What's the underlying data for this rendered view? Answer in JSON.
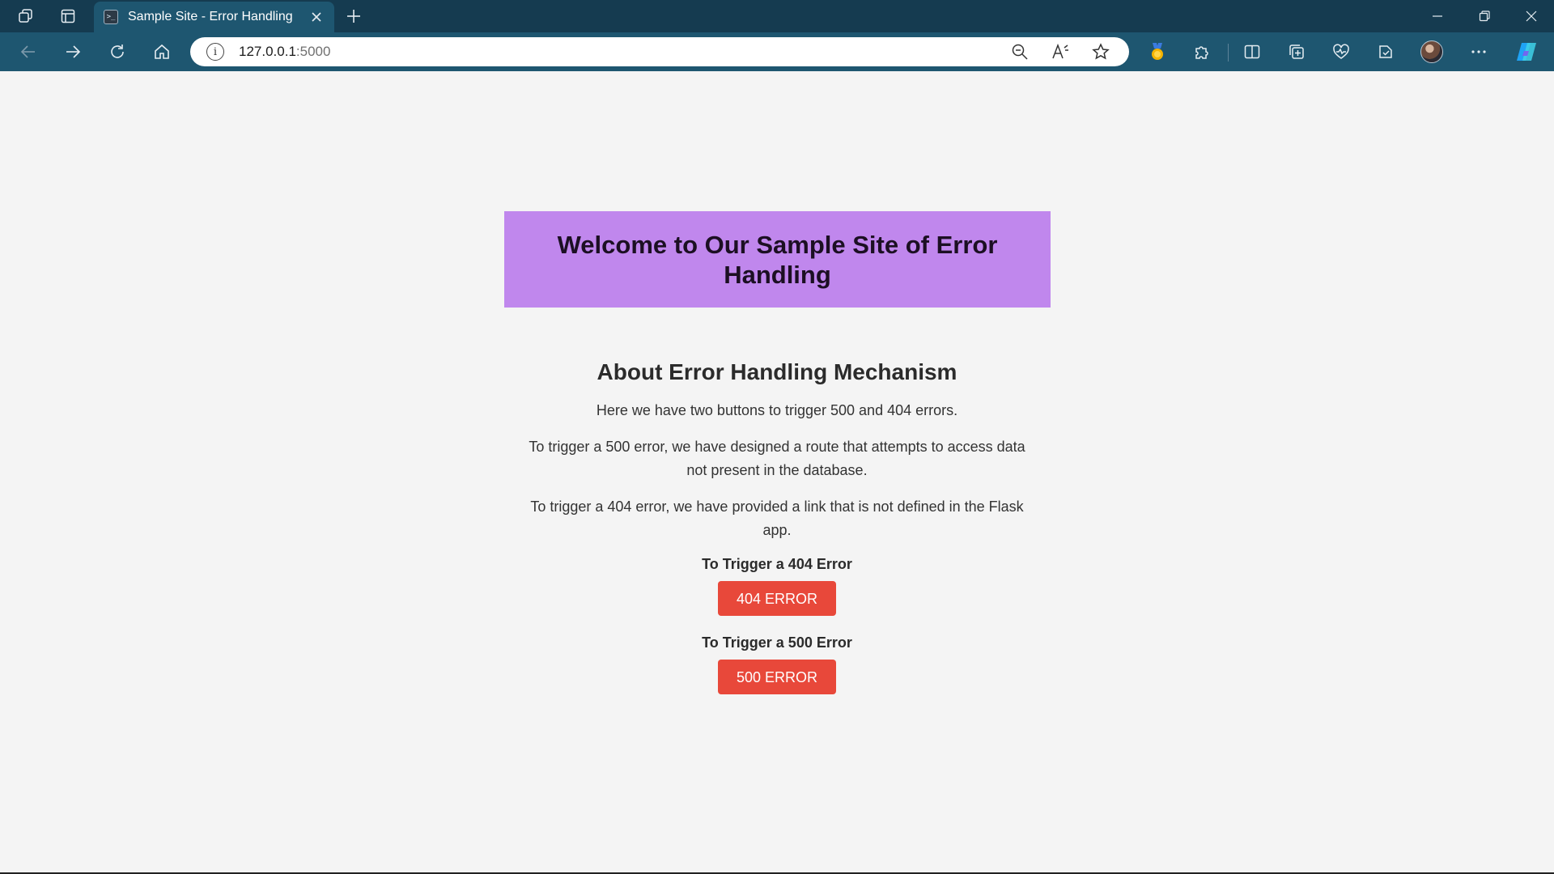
{
  "browser": {
    "tab": {
      "title": "Sample Site - Error Handling"
    },
    "address": {
      "host": "127.0.0.1",
      "port": ":5000"
    },
    "icons": {
      "workspaces": "workspaces-icon",
      "tab_actions": "tab-actions-icon",
      "close_tab": "close-icon",
      "new_tab": "plus-icon",
      "back": "back-arrow-icon",
      "forward": "forward-arrow-icon",
      "refresh": "refresh-icon",
      "home": "home-icon",
      "site_info": "info-icon",
      "zoom": "zoom-out-icon",
      "read_aloud": "read-aloud-icon",
      "favorite": "star-icon",
      "rewards": "medal-icon",
      "extensions": "puzzle-icon",
      "split_screen": "split-screen-icon",
      "collections": "collections-icon",
      "browser_essentials": "heart-pulse-icon",
      "sidebar_tool": "shield-check-icon",
      "profile": "avatar",
      "more": "more-dots-icon",
      "copilot": "copilot-icon"
    }
  },
  "page": {
    "hero_title": "Welcome to Our Sample Site of Error Handling",
    "about_title": "About Error Handling Mechanism",
    "paragraphs": [
      "Here we have two buttons to trigger 500 and 404 errors.",
      "To trigger a 500 error, we have designed a route that attempts to access data not present in the database.",
      "To trigger a 404 error, we have provided a link that is not defined in the Flask app."
    ],
    "trigger_404_label": "To Trigger a 404 Error",
    "button_404": "404 ERROR",
    "trigger_500_label": "To Trigger a 500 Error",
    "button_500": "500 ERROR"
  },
  "colors": {
    "hero_bg": "#c087ed",
    "button_bg": "#e8483a",
    "page_bg": "#f4f4f4",
    "chrome_dark": "#153b50",
    "chrome_toolbar": "#1e5670"
  }
}
